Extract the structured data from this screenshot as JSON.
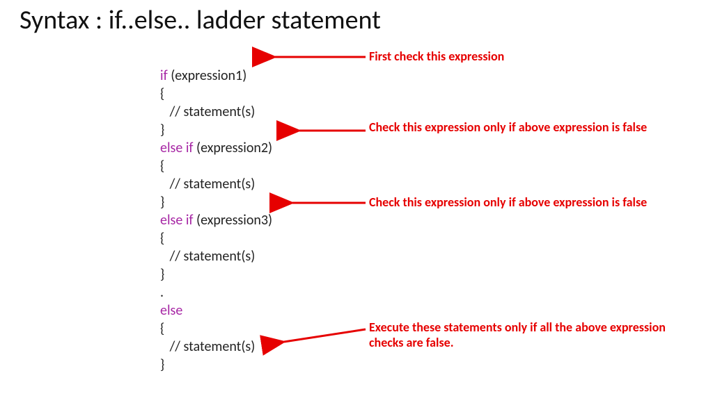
{
  "title": "Syntax : if..else.. ladder statement",
  "code": {
    "kw_if": "if",
    "expr1": " (expression1)",
    "brace_open": "{",
    "stmt": "   // statement(s)",
    "brace_close": "}",
    "kw_elseif": "else if",
    "expr2": " (expression2)",
    "expr3": " (expression3)",
    "dot": ".",
    "kw_else": "else"
  },
  "annotations": {
    "a1": "First check this expression",
    "a2": "Check this expression only if above expression\nis false",
    "a3": "Check this expression only if above expression is\nfalse",
    "a4": "Execute these statements only if all the above\nexpression checks are false."
  },
  "colors": {
    "keyword": "#a626a4",
    "annotation": "#e60000"
  }
}
